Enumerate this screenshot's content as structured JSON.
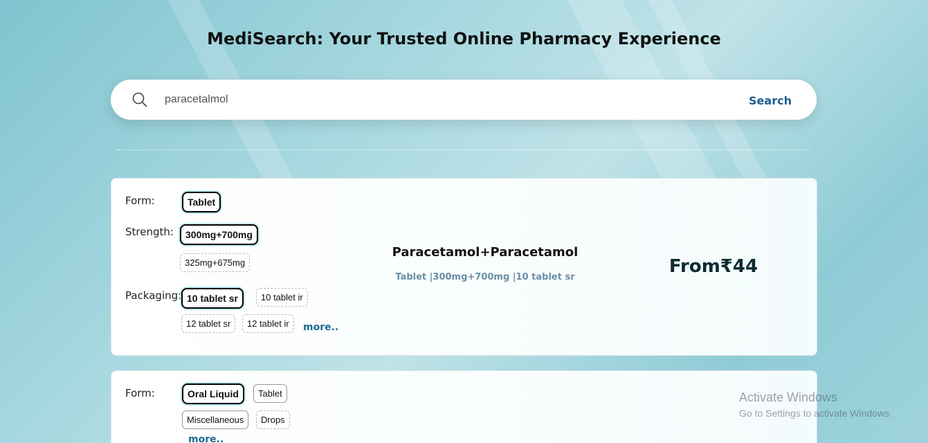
{
  "header": {
    "title": "MediSearch: Your Trusted Online Pharmacy Experience"
  },
  "search": {
    "value": "paracetalmol",
    "button_label": "Search",
    "icon": "search-icon"
  },
  "cards": [
    {
      "form_label": "Form:",
      "forms": [
        "Tablet"
      ],
      "strength_label": "Strength:",
      "strengths": [
        "300mg+700mg",
        "325mg+675mg"
      ],
      "packaging_label": "Packaging:",
      "packagings": [
        "10 tablet sr",
        "10 tablet ir",
        "12 tablet sr",
        "12 tablet ir"
      ],
      "more_label": "more..",
      "name": "Paracetamol+Paracetamol",
      "description": "Tablet |300mg+700mg |10 tablet sr",
      "price": "From₹44"
    },
    {
      "form_label": "Form:",
      "forms": [
        "Oral Liquid",
        "Tablet",
        "Miscellaneous",
        "Drops"
      ],
      "more_label": "more.."
    }
  ],
  "watermark": {
    "line1": "Activate Windows",
    "line2": "Go to Settings to activate Windows."
  },
  "colors": {
    "accent": "#1a5f8f",
    "more_link": "#1e6a94",
    "price": "#0d2b33"
  }
}
